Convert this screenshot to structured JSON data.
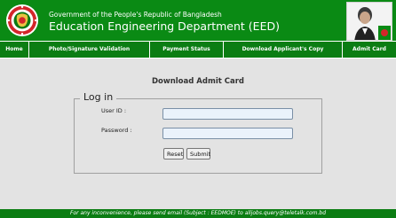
{
  "header": {
    "government_line": "Government of the People's Republic of Bangladesh",
    "department_title": "Education Engineering Department (EED)",
    "logo_icon": "bangladesh-government-seal-icon",
    "portrait_image": "portrait-photo"
  },
  "nav": {
    "items": [
      {
        "label": "Home"
      },
      {
        "label": "Photo/Signature Validation"
      },
      {
        "label": "Payment Status"
      },
      {
        "label": "Download Applicant's Copy"
      },
      {
        "label": "Admit Card"
      }
    ]
  },
  "main": {
    "page_title": "Download Admit Card",
    "login": {
      "legend": "Log in",
      "user_id_label": "User ID :",
      "user_id_value": "",
      "password_label": "Password :",
      "password_value": "",
      "reset_label": "Reset",
      "submit_label": "Submit"
    }
  },
  "footer": {
    "text": "For any inconvenience, please send email (Subject : EEDMOE) to alljobs.query@teletalk.com.bd"
  },
  "colors": {
    "header_green": "#0a8a14",
    "nav_green": "#0b7d13",
    "page_background": "#e3e3e3",
    "seal_red": "#d3262a"
  }
}
